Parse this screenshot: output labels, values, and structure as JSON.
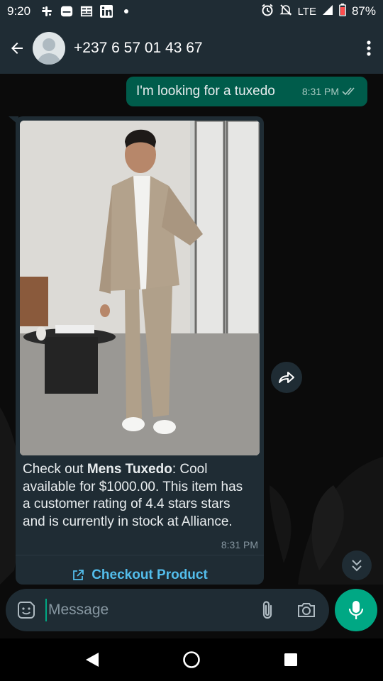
{
  "status_bar": {
    "time": "9:20",
    "network": "LTE",
    "battery": "87%",
    "notification_icons": [
      "slack-icon",
      "message-icon",
      "news-icon",
      "linkedin-icon",
      "dot-icon"
    ]
  },
  "header": {
    "contact_name": "+237 6 57 01 43 67"
  },
  "messages": {
    "outgoing": {
      "text": "I'm looking for a tuxedo",
      "time": "8:31 PM"
    },
    "incoming": {
      "text_prefix": "Check out ",
      "product_name": "Mens Tuxedo",
      "text_suffix": ": Cool available for $1000.00. This item has a customer rating of 4.4 stars stars and is currently in stock at Alliance.",
      "time": "8:31 PM",
      "button_label": "Checkout Product"
    }
  },
  "input": {
    "placeholder": "Message"
  },
  "colors": {
    "header_bg": "#1f2c34",
    "outgoing_bubble": "#005c4b",
    "accent": "#00a884",
    "link": "#53bdeb"
  }
}
